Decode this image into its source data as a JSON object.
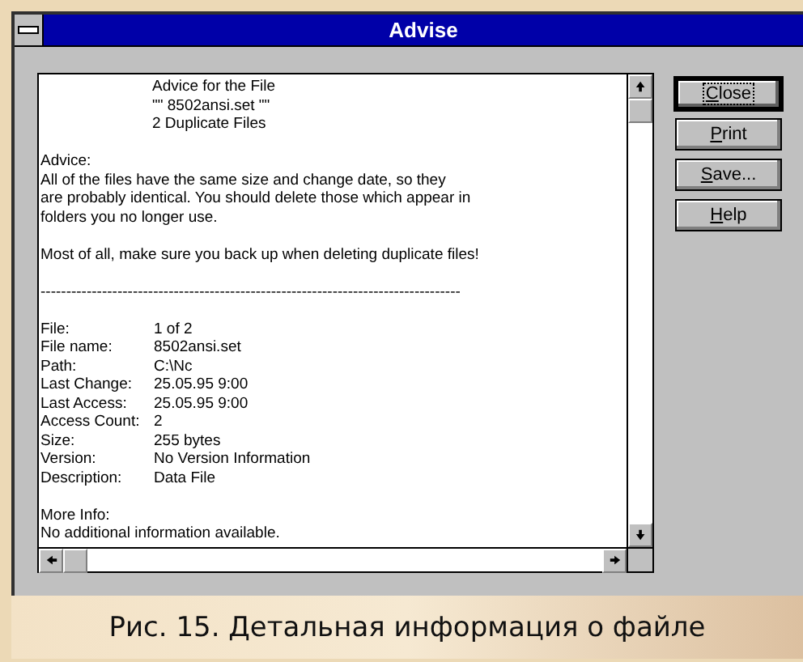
{
  "window": {
    "title": "Advise"
  },
  "report": {
    "heading": [
      "Advice for the File",
      "\"\" 8502ansi.set \"\"",
      "2 Duplicate Files"
    ],
    "advice_label": "Advice:",
    "advice_lines": [
      "All of the files have the same size and change date, so they",
      "are probably identical.  You should delete those which appear in",
      "folders you no longer use."
    ],
    "note": "Most of all, make sure you back up when deleting duplicate files!",
    "separator": "----------------------------------------------------------------------------------",
    "fields": [
      {
        "label": "File:",
        "value": "1 of 2"
      },
      {
        "label": "File name:",
        "value": "8502ansi.set"
      },
      {
        "label": "Path:",
        "value": "C:\\Nc"
      },
      {
        "label": "Last Change:",
        "value": "25.05.95  9:00"
      },
      {
        "label": "Last Access:",
        "value": "25.05.95  9:00"
      },
      {
        "label": "Access Count:",
        "value": "2"
      },
      {
        "label": "Size:",
        "value": "255 bytes"
      },
      {
        "label": "Version:",
        "value": "No Version Information"
      },
      {
        "label": "Description:",
        "value": "Data File"
      }
    ],
    "more_info_label": "More Info:",
    "more_info_text": "No additional information available."
  },
  "buttons": [
    {
      "label": "Close",
      "focused": true
    },
    {
      "label": "Print",
      "focused": false
    },
    {
      "label": "Save...",
      "focused": false
    },
    {
      "label": "Help",
      "focused": false
    }
  ],
  "caption": "Рис. 15. Детальная информация о файле"
}
